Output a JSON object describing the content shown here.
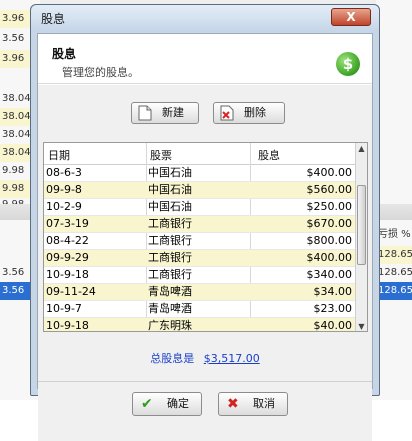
{
  "background": {
    "left_values": [
      "",
      "3.96",
      "3.56",
      "3.96",
      "38.04",
      "38.04",
      "38.04",
      "38.04",
      "9.98",
      "9.98",
      "9.98",
      "",
      "",
      "",
      "3.56",
      "3.56"
    ],
    "right_values": [
      "",
      "",
      "",
      "",
      "",
      "",
      "",
      "",
      "",
      "",
      "",
      "",
      "亏损 %",
      "128.65",
      "128.65",
      "128.65"
    ],
    "top_partial": [
      "222,471",
      "271,344"
    ]
  },
  "dialog": {
    "title": "股息",
    "close_label": "X",
    "header_title": "股息",
    "header_subtitle": "管理您的股息。",
    "icon": "dollar-icon",
    "icon_glyph": "$",
    "toolbar": {
      "new_label": "新建",
      "delete_label": "删除"
    },
    "table": {
      "columns": [
        "日期",
        "股票",
        "股息"
      ],
      "rows": [
        {
          "date": "08-6-3",
          "stock": "中国石油",
          "dividend": "$400.00"
        },
        {
          "date": "09-9-8",
          "stock": "中国石油",
          "dividend": "$560.00"
        },
        {
          "date": "10-2-9",
          "stock": "中国石油",
          "dividend": "$250.00"
        },
        {
          "date": "07-3-19",
          "stock": "工商银行",
          "dividend": "$670.00"
        },
        {
          "date": "08-4-22",
          "stock": "工商银行",
          "dividend": "$800.00"
        },
        {
          "date": "09-9-29",
          "stock": "工商银行",
          "dividend": "$400.00"
        },
        {
          "date": "10-9-18",
          "stock": "工商银行",
          "dividend": "$340.00"
        },
        {
          "date": "09-11-24",
          "stock": "青岛啤酒",
          "dividend": "$34.00"
        },
        {
          "date": "10-9-7",
          "stock": "青岛啤酒",
          "dividend": "$23.00"
        },
        {
          "date": "10-9-18",
          "stock": "广东明珠",
          "dividend": "$40.00"
        }
      ]
    },
    "total_label": "总股息是",
    "total_value": "$3,517.00",
    "ok_label": "确定",
    "cancel_label": "取消"
  }
}
